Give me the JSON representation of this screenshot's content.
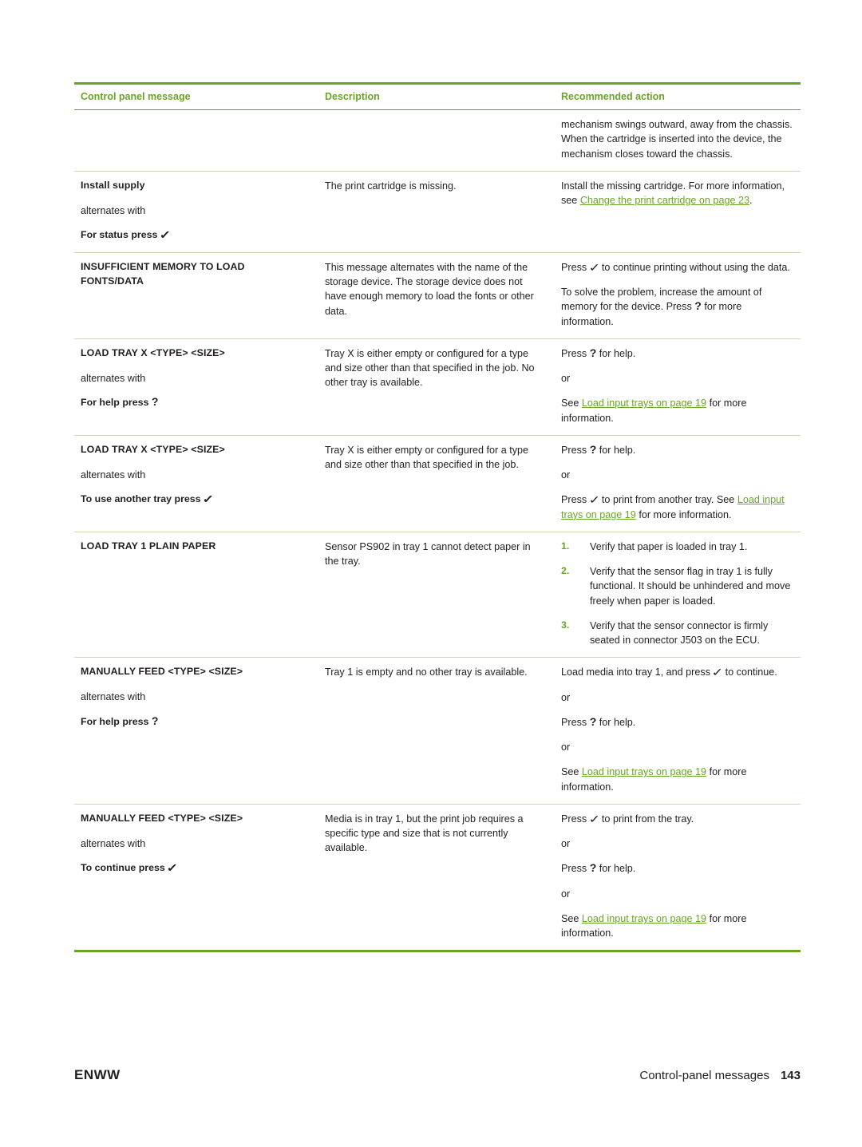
{
  "document": {
    "footer_left": "ENWW",
    "footer_right_label": "Control-panel messages",
    "footer_page": "143"
  },
  "table": {
    "headers": {
      "col1": "Control panel message",
      "col2": "Description",
      "col3": "Recommended action"
    },
    "accent_color": "#6aa426",
    "rows": [
      {
        "id": "continued-row",
        "message": "",
        "message_alt_label": "",
        "message_sub": "",
        "description": "",
        "action": "mechanism swings outward, away from the chassis. When the cartridge is inserted into the device, the mechanism closes toward the chassis."
      },
      {
        "id": "install-supply",
        "message": "Install supply",
        "message_alt_label": "alternates with",
        "message_sub": "For status press",
        "message_sub_glyph": "check-glyph",
        "description": "The print cartridge is missing.",
        "action_pre": "Install the missing cartridge. For more information, see ",
        "action_link": "Change the print cartridge on page 23",
        "action_post": "."
      },
      {
        "id": "insufficient-memory",
        "message": "INSUFFICIENT MEMORY TO LOAD FONTS/DATA",
        "description": "This message alternates with the name of the storage device. The storage device does not have enough memory to load the fonts or other data.",
        "action_p1_a": "Press ",
        "action_p1_b": " to continue printing without using the data.",
        "action_p2_a": "To solve the problem, increase the amount of memory for the device. Press ",
        "action_p2_b": " for more information."
      },
      {
        "id": "load-tray-x-1",
        "message": "LOAD TRAY X <TYPE> <SIZE>",
        "message_alt_label": "alternates with",
        "message_sub": "For help press",
        "message_sub_glyph": "question-glyph",
        "description": "Tray X is either empty or configured for a type and size other than that specified in the job. No other tray is available.",
        "action_p1_a": "Press ",
        "action_p1_b": " for help.",
        "action_p2": "or",
        "action_p3_pre": "See ",
        "action_p3_link": "Load input trays on page 19",
        "action_p3_post": " for more information."
      },
      {
        "id": "load-tray-x-2",
        "message": "LOAD TRAY X <TYPE> <SIZE>",
        "message_alt_label": "alternates with",
        "message_sub": "To use another tray press",
        "message_sub_glyph": "check-glyph",
        "description": "Tray X is either empty or configured for a type and size other than that specified in the job.",
        "action_p1_a": "Press ",
        "action_p1_b": " for help.",
        "action_p2": "or",
        "action_p3_pre": "Press ",
        "action_p3_mid": " to print from another tray. See ",
        "action_p3_link": "Load input trays on page 19",
        "action_p3_post": " for more information."
      },
      {
        "id": "load-tray-1-plain",
        "message": "LOAD TRAY 1 PLAIN PAPER",
        "description": "Sensor PS902 in tray 1 cannot detect paper in the tray.",
        "steps": [
          {
            "num": "1.",
            "text": "Verify that paper is loaded in tray 1."
          },
          {
            "num": "2.",
            "text": "Verify that the sensor flag in tray 1 is fully functional. It should be unhindered and move freely when paper is loaded."
          },
          {
            "num": "3.",
            "text": "Verify that the sensor connector is firmly seated in connector J503 on the ECU."
          }
        ]
      },
      {
        "id": "manually-feed-1",
        "message": "MANUALLY FEED <TYPE> <SIZE>",
        "message_alt_label": "alternates with",
        "message_sub": "For help press",
        "message_sub_glyph": "question-glyph",
        "description": "Tray 1 is empty and no other tray is available.",
        "action_p1_a": "Load media into tray 1, and press ",
        "action_p1_b": " to continue.",
        "action_p2": "or",
        "action_p3_a": "Press ",
        "action_p3_b": " for help.",
        "action_p4": "or",
        "action_p5_pre": "See ",
        "action_p5_link": "Load input trays on page 19",
        "action_p5_post": " for more information."
      },
      {
        "id": "manually-feed-2",
        "message": "MANUALLY FEED <TYPE> <SIZE>",
        "message_alt_label": "alternates with",
        "message_sub": "To continue press",
        "message_sub_glyph": "check-glyph",
        "description": "Media is in tray 1, but the print job requires a specific type and size that is not currently available.",
        "action_p1_a": "Press ",
        "action_p1_b": " to print from the tray.",
        "action_p2": "or",
        "action_p3_a": "Press ",
        "action_p3_b": " for help.",
        "action_p4": "or",
        "action_p5_pre": "See ",
        "action_p5_link": "Load input trays on page 19",
        "action_p5_post": " for more information."
      }
    ]
  },
  "glyphs": {
    "check": "✓",
    "question": "?"
  }
}
